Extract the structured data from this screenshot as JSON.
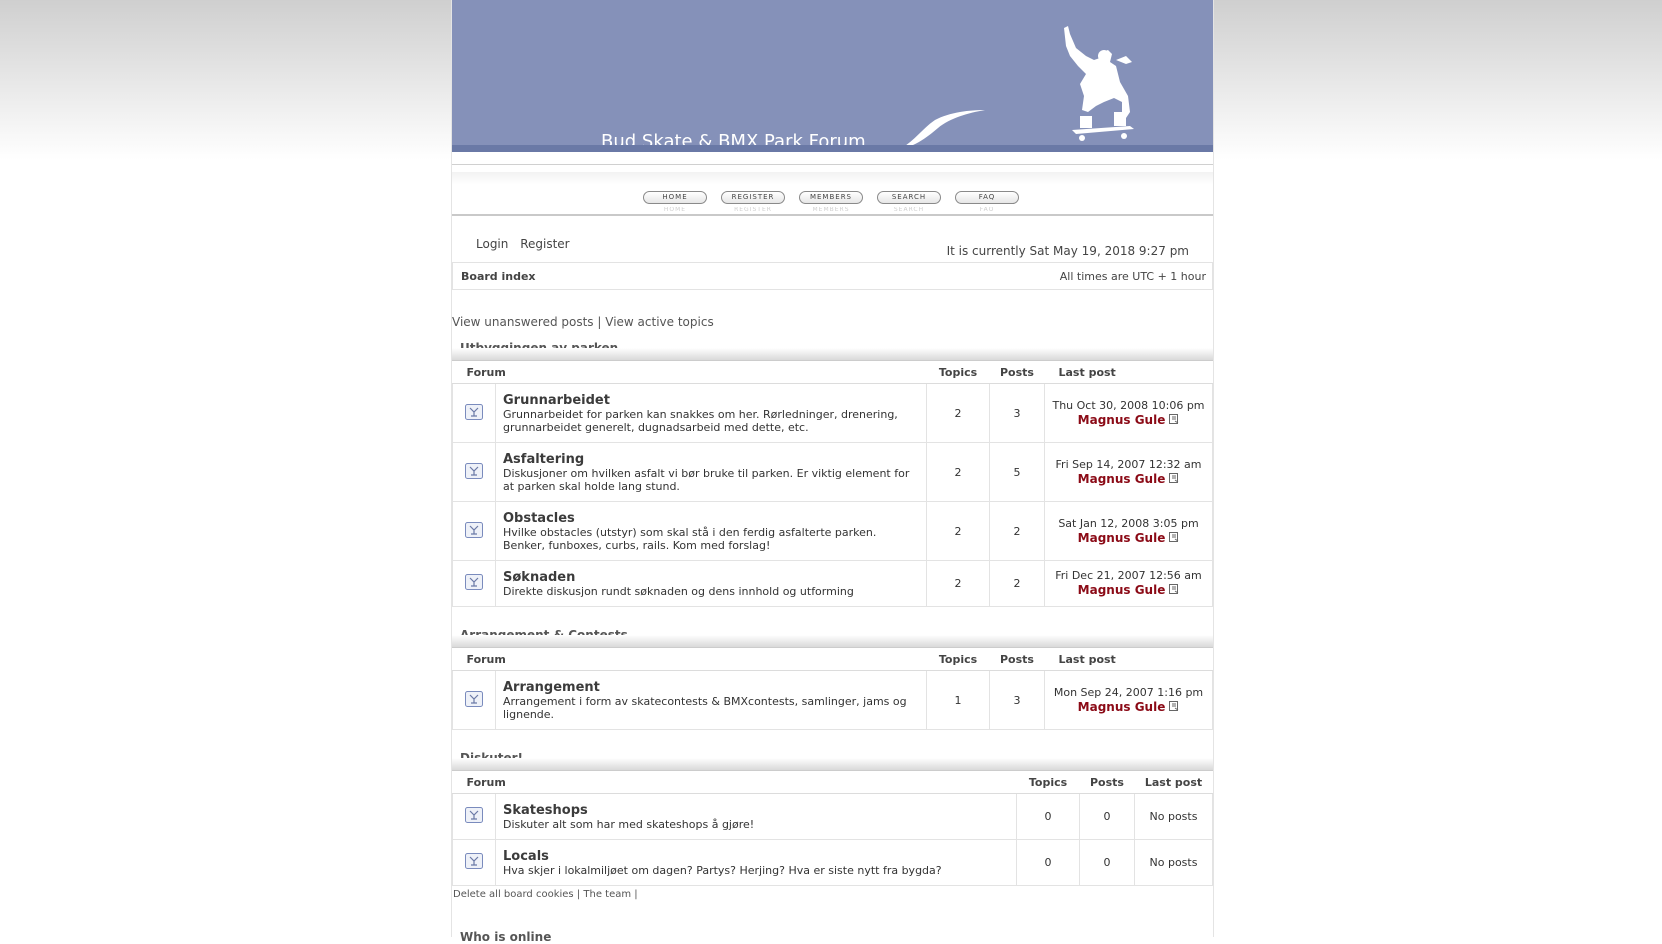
{
  "site": {
    "title": "Bud Skate & BMX Park Forum"
  },
  "nav": [
    {
      "label": "HOME"
    },
    {
      "label": "REGISTER"
    },
    {
      "label": "MEMBERS"
    },
    {
      "label": "SEARCH"
    },
    {
      "label": "FAQ"
    }
  ],
  "userbar": {
    "login": "Login",
    "register": "Register",
    "datetime": "It is currently Sat May 19, 2018 9:27 pm"
  },
  "breadcrumb": {
    "label": "Board index",
    "timezone": "All times are UTC + 1 hour"
  },
  "links": {
    "unanswered": "View unanswered posts",
    "separator": "|",
    "active": "View active topics"
  },
  "table_headers": {
    "forum": "Forum",
    "topics": "Topics",
    "posts": "Posts",
    "last_post": "Last post"
  },
  "categories": [
    {
      "title": "Utbyggingen av parken",
      "forums": [
        {
          "name": "Grunnarbeidet",
          "desc": "Grunnarbeidet for parken kan snakkes om her. Rørledninger, drenering, grunnarbeidet generelt, dugnadsarbeid med dette, etc.",
          "topics": "2",
          "posts": "3",
          "last_date": "Thu Oct 30, 2008 10:06 pm",
          "last_author": "Magnus Gule"
        },
        {
          "name": "Asfaltering",
          "desc": "Diskusjoner om hvilken asfalt vi bør bruke til parken. Er viktig element for at parken skal holde lang stund.",
          "topics": "2",
          "posts": "5",
          "last_date": "Fri Sep 14, 2007 12:32 am",
          "last_author": "Magnus Gule"
        },
        {
          "name": "Obstacles",
          "desc": "Hvilke obstacles (utstyr) som skal stå i den ferdig asfalterte parken. Benker, funboxes, curbs, rails. Kom med forslag!",
          "topics": "2",
          "posts": "2",
          "last_date": "Sat Jan 12, 2008 3:05 pm",
          "last_author": "Magnus Gule"
        },
        {
          "name": "Søknaden",
          "desc": "Direkte diskusjon rundt søknaden og dens innhold og utforming",
          "topics": "2",
          "posts": "2",
          "last_date": "Fri Dec 21, 2007 12:56 am",
          "last_author": "Magnus Gule"
        }
      ]
    },
    {
      "title": "Arrangement & Contests",
      "forums": [
        {
          "name": "Arrangement",
          "desc": "Arrangement i form av skatecontests & BMXcontests, samlinger, jams og lignende.",
          "topics": "1",
          "posts": "3",
          "last_date": "Mon Sep 24, 2007 1:16 pm",
          "last_author": "Magnus Gule"
        }
      ]
    },
    {
      "title": "Diskuter!",
      "forums": [
        {
          "name": "Skateshops",
          "desc": "Diskuter alt som har med skateshops å gjøre!",
          "topics": "0",
          "posts": "0",
          "last_text": "No posts"
        },
        {
          "name": "Locals",
          "desc": "Hva skjer i lokalmiljøet om dagen? Partys? Herjing? Hva er siste nytt fra bygda?",
          "topics": "0",
          "posts": "0",
          "last_text": "No posts"
        }
      ]
    }
  ],
  "footer": {
    "delete_cookies": "Delete all board cookies",
    "sep1": "|",
    "team": "The team",
    "sep2": "|"
  },
  "whoisonline": {
    "title": "Who is online"
  }
}
